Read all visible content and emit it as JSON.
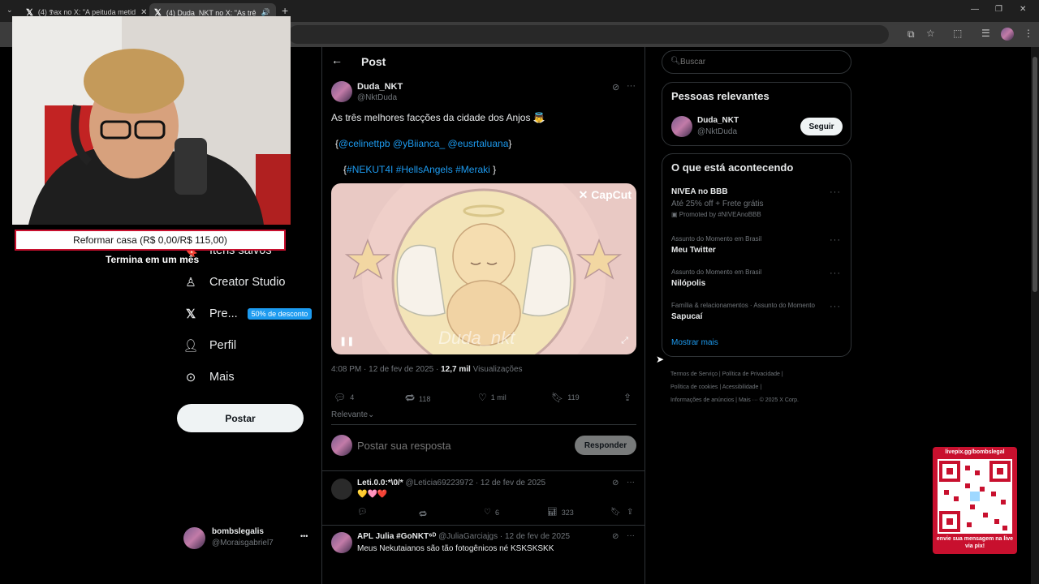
{
  "browser": {
    "tabs": [
      {
        "title": "(4) 𝕯ax no X: \"A peituda metid",
        "active": false
      },
      {
        "title": "(4) Duda_NKT no X: \"As trê",
        "active": true
      }
    ],
    "new_tab": "+",
    "window_controls": {
      "minimize": "—",
      "restore": "❐",
      "close": "✕"
    }
  },
  "overlay": {
    "goal_text": "Reformar casa (R$ 0,00/R$ 115,00)",
    "goal_subtext": "Termina em um mês",
    "qr": {
      "top_text": "livepix.gg/bombslegal",
      "bottom_text": "envie sua mensagem na live via pix!"
    }
  },
  "sidebar": {
    "items": [
      {
        "label": "Itens salvos",
        "icon": "bookmark-icon"
      },
      {
        "label": "Creator Studio",
        "icon": "creator-studio-icon"
      },
      {
        "label": "Pre...",
        "icon": "x-logo-icon",
        "badge": "50% de desconto"
      },
      {
        "label": "Perfil",
        "icon": "person-icon"
      },
      {
        "label": "Mais",
        "icon": "more-circle-icon"
      }
    ],
    "post_button": "Postar",
    "account": {
      "name": "bombslegalis",
      "handle": "@Moraisgabriel7",
      "menu": "•••"
    }
  },
  "post": {
    "header_title": "Post",
    "back_icon": "←",
    "author": {
      "name": "Duda_NKT",
      "handle": "@NktDuda"
    },
    "text_line1": "As três melhores facções da cidade dos Anjos 👼",
    "mentions": {
      "open": "{",
      "m1": "@celinettpb",
      "m2": "@yBiianca_",
      "m3": "@eusrtaluana",
      "close": "}"
    },
    "hashtags": {
      "open": "{",
      "h1": "#NEKUT4I",
      "h2": "#HellsAngels",
      "h3": "#Meraki",
      "close": "}"
    },
    "media": {
      "watermark": "CapCut",
      "overlay_text": "Duda_nkt"
    },
    "timestamp": "4:08 PM · 12 de fev de 2025 · ",
    "views_count": "12,7 mil",
    "views_label": " Visualizações",
    "stats": {
      "replies": "4",
      "reposts": "118",
      "likes": "1 mil",
      "bookmarks": "119"
    },
    "sort_label": "Relevante",
    "reply_placeholder": "Postar sua resposta",
    "reply_button": "Responder"
  },
  "replies": [
    {
      "name": "Leti.0.0:*\\0/*",
      "handle": "@Leticia69223972",
      "date": "· 12 de fev de 2025",
      "text": "💛🩷❤️",
      "stats": {
        "replies": "",
        "reposts": "",
        "likes": "6",
        "views": "323"
      }
    },
    {
      "name": "APL Julia #GoNKT⁶ᴰ",
      "handle": "@JuliaGarciajgs",
      "date": "· 12 de fev de 2025",
      "text": "Meus Nekutaianos são tão fotogênicos né KSKSKSKK"
    }
  ],
  "right": {
    "search_placeholder": "Buscar",
    "relevant": {
      "title": "Pessoas relevantes",
      "name": "Duda_NKT",
      "handle": "@NktDuda",
      "follow": "Seguir"
    },
    "trends_title": "O que está acontecendo",
    "trends": [
      {
        "context": "",
        "title": "NIVEA no BBB",
        "sub": "Até 25% off + Frete grátis",
        "promo": "Promoted by #NIVEAnoBBB"
      },
      {
        "context": "Assunto do Momento em Brasil",
        "title": "Meu Twitter"
      },
      {
        "context": "Assunto do Momento em Brasil",
        "title": "Nilópolis"
      },
      {
        "context": "Família & relacionamentos · Assunto do Momento",
        "title": "Sapucaí"
      }
    ],
    "show_more": "Mostrar mais",
    "footer": {
      "l1": "Termos de Serviço",
      "l2": "Política de Privacidade",
      "l3": "Política de cookies",
      "l4": "Acessibilidade",
      "l5": "Informações de anúncios",
      "l6": "Mais ···",
      "l7": "© 2025 X Corp."
    }
  },
  "colors": {
    "accent": "#1d9bf0",
    "badge": "#1d9bf0",
    "goal_border": "#c8102e",
    "background": "#000000"
  }
}
